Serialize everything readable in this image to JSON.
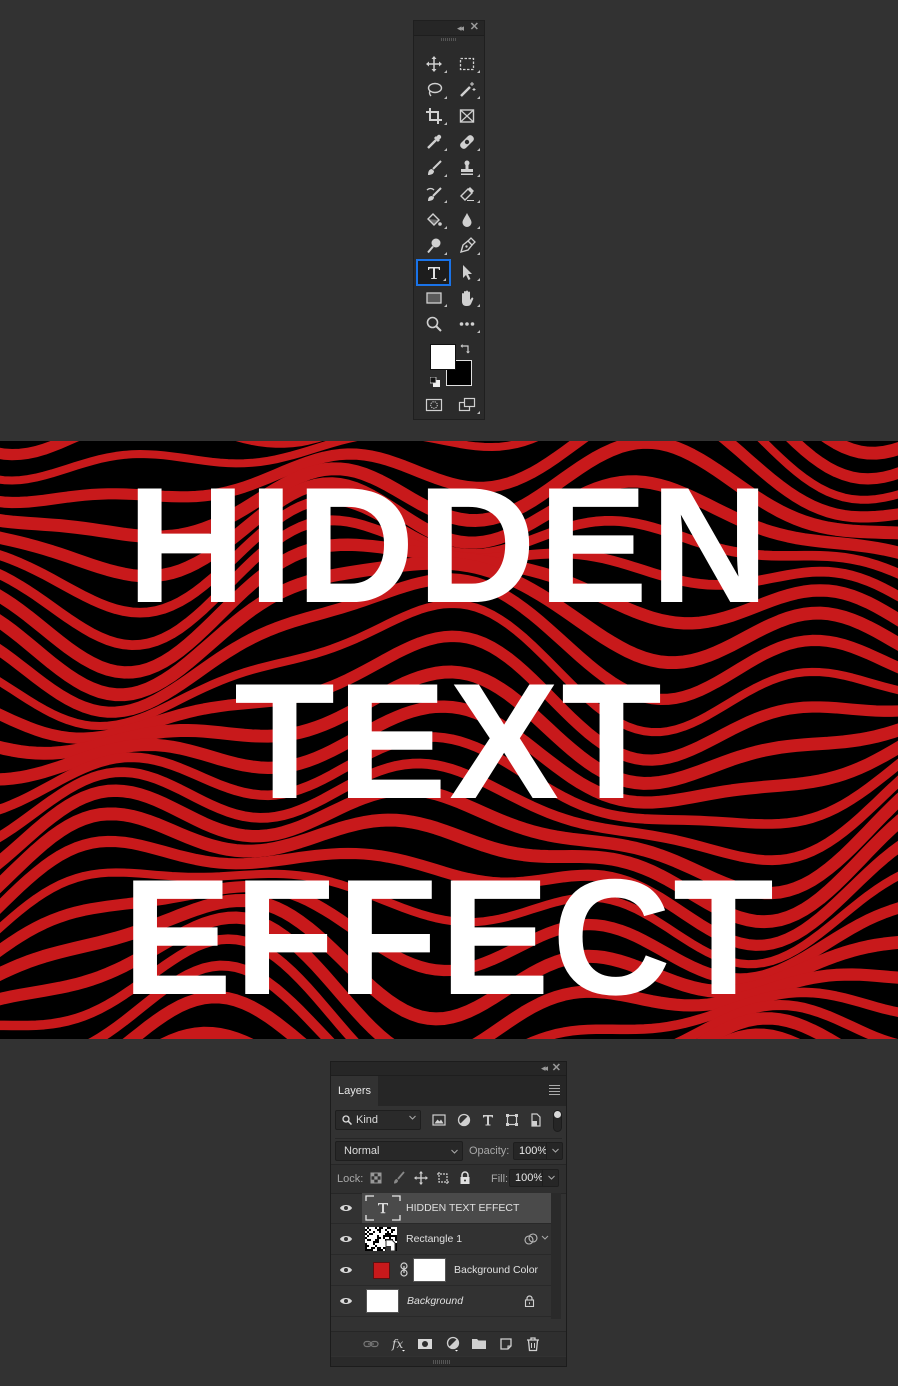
{
  "toolbar": {
    "collapse_label": "◂◂",
    "close_label": "✕",
    "tools": [
      {
        "name": "move-tool",
        "icon": "move-icon",
        "has_submenu": true
      },
      {
        "name": "rectangular-marquee-tool",
        "icon": "marquee-icon",
        "has_submenu": true
      },
      {
        "name": "lasso-tool",
        "icon": "lasso-icon",
        "has_submenu": true
      },
      {
        "name": "magic-wand-tool",
        "icon": "magic-wand-icon",
        "has_submenu": true
      },
      {
        "name": "crop-tool",
        "icon": "crop-icon",
        "has_submenu": true
      },
      {
        "name": "frame-tool",
        "icon": "frame-icon",
        "has_submenu": false
      },
      {
        "name": "eyedropper-tool",
        "icon": "eyedropper-icon",
        "has_submenu": true
      },
      {
        "name": "healing-brush-tool",
        "icon": "bandage-icon",
        "has_submenu": true
      },
      {
        "name": "brush-tool",
        "icon": "brush-icon",
        "has_submenu": true
      },
      {
        "name": "clone-stamp-tool",
        "icon": "stamp-icon",
        "has_submenu": true
      },
      {
        "name": "history-brush-tool",
        "icon": "history-brush-icon",
        "has_submenu": true
      },
      {
        "name": "eraser-tool",
        "icon": "eraser-icon",
        "has_submenu": true
      },
      {
        "name": "paint-bucket-tool",
        "icon": "paint-bucket-icon",
        "has_submenu": true
      },
      {
        "name": "blur-tool",
        "icon": "drop-icon",
        "has_submenu": true
      },
      {
        "name": "dodge-tool",
        "icon": "dodge-icon",
        "has_submenu": true
      },
      {
        "name": "pen-tool",
        "icon": "pen-icon",
        "has_submenu": true
      },
      {
        "name": "type-tool",
        "icon": "type-icon",
        "has_submenu": true,
        "active": true
      },
      {
        "name": "path-selection-tool",
        "icon": "arrow-icon",
        "has_submenu": true
      },
      {
        "name": "rectangle-tool",
        "icon": "rectangle-icon",
        "has_submenu": true
      },
      {
        "name": "hand-tool",
        "icon": "hand-icon",
        "has_submenu": true
      },
      {
        "name": "zoom-tool",
        "icon": "zoom-icon",
        "has_submenu": false
      },
      {
        "name": "edit-toolbar",
        "icon": "more-icon",
        "has_submenu": true
      }
    ],
    "foreground_color": "#ffffff",
    "background_color": "#000000",
    "bottom": [
      {
        "name": "quick-mask-button",
        "icon": "quick-mask-icon"
      },
      {
        "name": "screen-mode-button",
        "icon": "screen-mode-icon"
      }
    ]
  },
  "canvas": {
    "lines": [
      "HIDDEN",
      "TEXT",
      "EFFECT"
    ],
    "text_color": "#ffffff",
    "stripe_color": "#c8191b",
    "base_color": "#000000"
  },
  "layers_panel": {
    "collapse_label": "◂◂",
    "close_label": "✕",
    "tab": "Layers",
    "filter": {
      "kind_label": "Kind"
    },
    "blend_mode": "Normal",
    "opacity_label": "Opacity:",
    "opacity": "100%",
    "lock_label": "Lock:",
    "fill_label": "Fill:",
    "fill": "100%",
    "layers": [
      {
        "name": "HIDDEN TEXT EFFECT",
        "type": "text",
        "visible": true,
        "selected": true
      },
      {
        "name": "Rectangle 1",
        "type": "smart-object",
        "visible": true,
        "has_effects": true
      },
      {
        "name": "Background Color",
        "type": "fill",
        "visible": true,
        "swatch": "#c8191b"
      },
      {
        "name": "Background",
        "type": "background",
        "visible": true,
        "locked": true,
        "italic": true
      }
    ]
  }
}
